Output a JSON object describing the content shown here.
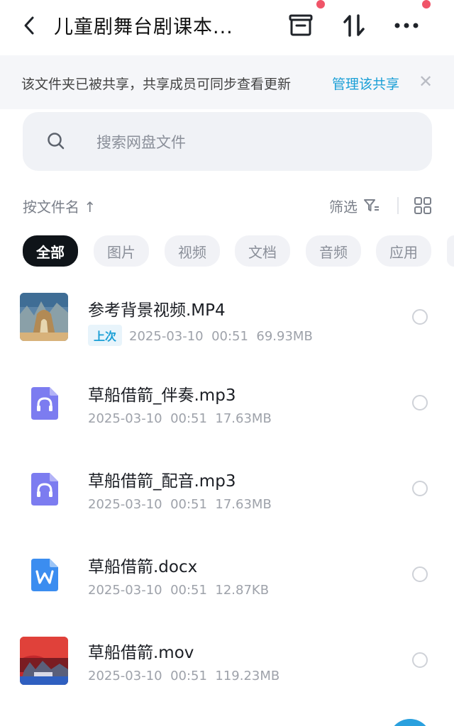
{
  "header": {
    "title": "儿童剧舞台剧课本...",
    "icons": [
      "back-icon",
      "box-icon",
      "sort-swap-icon",
      "more-icon"
    ]
  },
  "banner": {
    "text": "该文件夹已被共享，共享成员可同步查看更新",
    "link": "管理该共享",
    "close": "✕"
  },
  "search": {
    "placeholder": "搜索网盘文件"
  },
  "toolbar": {
    "sort": "按文件名 ↑",
    "filter": "筛选"
  },
  "chips": [
    "全部",
    "图片",
    "视频",
    "文档",
    "音频",
    "应用"
  ],
  "colors": {
    "accent": "#1a9fd6",
    "badge": "#f05468",
    "audio": "#7c7cf0",
    "word": "#3b8df0"
  },
  "files": [
    {
      "name": "参考背景视频.MP4",
      "tag": "上次",
      "date": "2025-03-10",
      "time": "00:51",
      "size": "69.93MB",
      "kind": "video"
    },
    {
      "name": "草船借箭_伴奏.mp3",
      "date": "2025-03-10",
      "time": "00:51",
      "size": "17.63MB",
      "kind": "audio"
    },
    {
      "name": "草船借箭_配音.mp3",
      "date": "2025-03-10",
      "time": "00:51",
      "size": "17.63MB",
      "kind": "audio"
    },
    {
      "name": "草船借箭.docx",
      "date": "2025-03-10",
      "time": "00:51",
      "size": "12.87KB",
      "kind": "word"
    },
    {
      "name": "草船借箭.mov",
      "date": "2025-03-10",
      "time": "00:51",
      "size": "119.23MB",
      "kind": "video"
    }
  ]
}
